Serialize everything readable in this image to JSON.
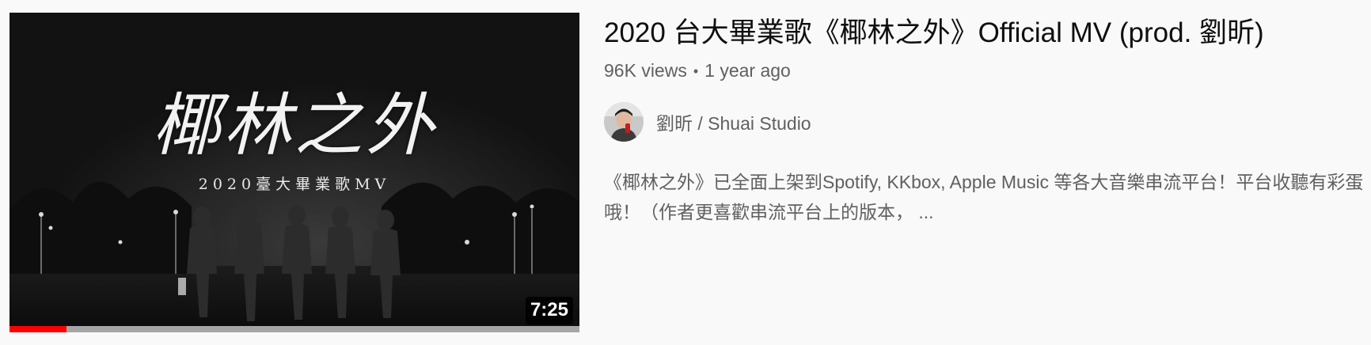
{
  "video": {
    "thumbnail": {
      "overlay_title": "椰林之外",
      "overlay_subtitle": "2020臺大畢業歌MV",
      "duration": "7:25",
      "watched_fraction": 0.1,
      "progress_color": "#ff0000"
    },
    "title": "2020 台大畢業歌《椰林之外》Official MV (prod. 劉昕)",
    "views": "96K views",
    "age": "1 year ago",
    "separator": "•",
    "channel": {
      "name": "劉昕 / Shuai Studio",
      "avatar_icon": "channel-avatar"
    },
    "description": "《椰林之外》已全面上架到Spotify, KKbox, Apple Music 等各大音樂串流平台！平台收聽有彩蛋哦！（作者更喜歡串流平台上的版本， ..."
  }
}
